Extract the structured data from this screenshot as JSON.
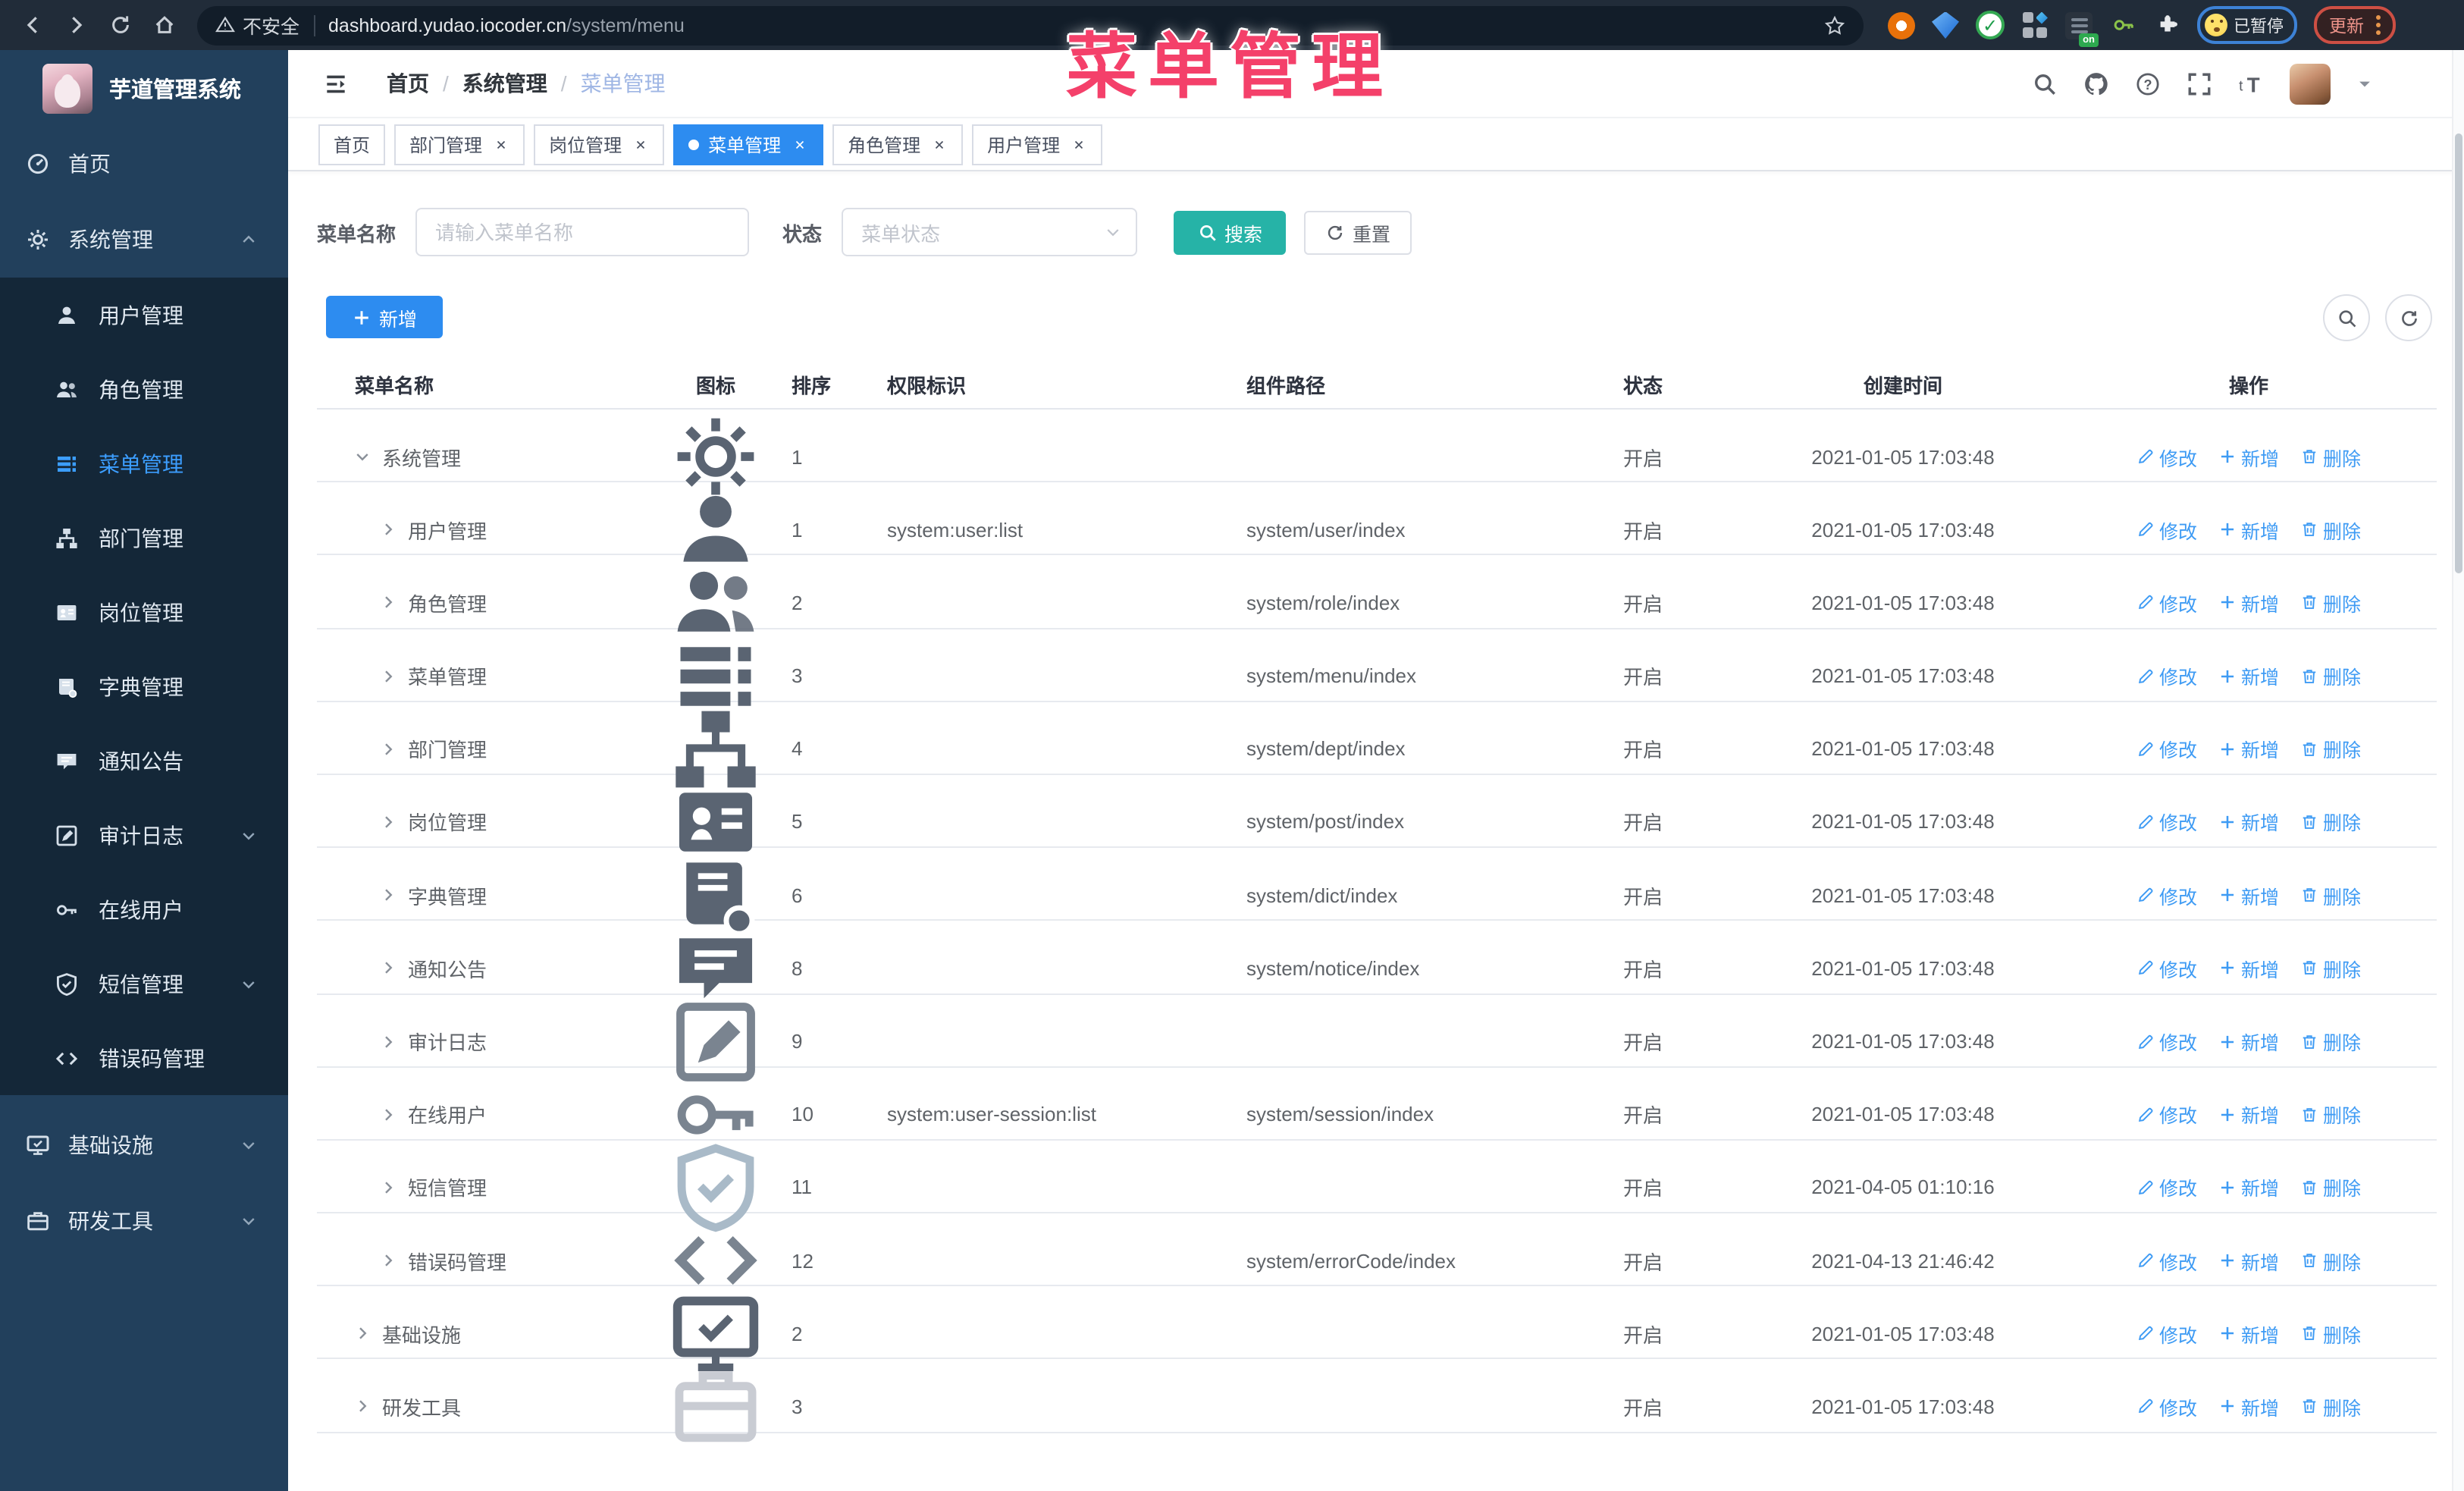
{
  "browser": {
    "security_label": "不安全",
    "url_domain": "dashboard.yudao.iocoder.cn",
    "url_path": "/system/menu",
    "extension_on_badge": "on",
    "paused_badge_label": "已暂停",
    "update_button_label": "更新"
  },
  "watermark": "菜单管理",
  "sidebar": {
    "app_title": "芋道管理系统",
    "items": [
      {
        "label": "首页",
        "icon": "dashboard",
        "sub": false,
        "caret": null,
        "active": false
      },
      {
        "label": "系统管理",
        "icon": "gear",
        "sub": false,
        "caret": "up",
        "active": false
      },
      {
        "label": "用户管理",
        "icon": "user",
        "sub": true,
        "caret": null,
        "active": false
      },
      {
        "label": "角色管理",
        "icon": "users",
        "sub": true,
        "caret": null,
        "active": false
      },
      {
        "label": "菜单管理",
        "icon": "menu",
        "sub": true,
        "caret": null,
        "active": true
      },
      {
        "label": "部门管理",
        "icon": "tree",
        "sub": true,
        "caret": null,
        "active": false
      },
      {
        "label": "岗位管理",
        "icon": "badge",
        "sub": true,
        "caret": null,
        "active": false
      },
      {
        "label": "字典管理",
        "icon": "dict",
        "sub": true,
        "caret": null,
        "active": false
      },
      {
        "label": "通知公告",
        "icon": "announce",
        "sub": true,
        "caret": null,
        "active": false
      },
      {
        "label": "审计日志",
        "icon": "log",
        "sub": true,
        "caret": "down",
        "active": false
      },
      {
        "label": "在线用户",
        "icon": "key",
        "sub": true,
        "caret": null,
        "active": false
      },
      {
        "label": "短信管理",
        "icon": "shield",
        "sub": true,
        "caret": "down",
        "active": false
      },
      {
        "label": "错误码管理",
        "icon": "code",
        "sub": true,
        "caret": null,
        "active": false
      },
      {
        "label": "基础设施",
        "icon": "monitor",
        "sub": false,
        "caret": "down",
        "active": false,
        "gap": true
      },
      {
        "label": "研发工具",
        "icon": "tool",
        "sub": false,
        "caret": "down",
        "active": false
      }
    ]
  },
  "topbar": {
    "breadcrumbs": [
      "首页",
      "系统管理",
      "菜单管理"
    ],
    "separator": "/"
  },
  "tabs": [
    {
      "label": "首页",
      "closable": false,
      "active": false
    },
    {
      "label": "部门管理",
      "closable": true,
      "active": false
    },
    {
      "label": "岗位管理",
      "closable": true,
      "active": false
    },
    {
      "label": "菜单管理",
      "closable": true,
      "active": true
    },
    {
      "label": "角色管理",
      "closable": true,
      "active": false
    },
    {
      "label": "用户管理",
      "closable": true,
      "active": false
    }
  ],
  "filters": {
    "name_label": "菜单名称",
    "name_placeholder": "请输入菜单名称",
    "status_label": "状态",
    "status_placeholder": "菜单状态",
    "search_label": "搜索",
    "reset_label": "重置"
  },
  "toolbar": {
    "add_label": "新增"
  },
  "table": {
    "columns": [
      "菜单名称",
      "图标",
      "排序",
      "权限标识",
      "组件路径",
      "状态",
      "创建时间",
      "操作"
    ],
    "action_labels": [
      "修改",
      "新增",
      "删除"
    ],
    "rows": [
      {
        "name": "系统管理",
        "level": 0,
        "expanded": true,
        "icon": "gear",
        "tone": "",
        "sort": "1",
        "perm": "",
        "path": "",
        "status": "开启",
        "time": "2021-01-05 17:03:48"
      },
      {
        "name": "用户管理",
        "level": 1,
        "expanded": false,
        "icon": "user",
        "tone": "",
        "sort": "1",
        "perm": "system:user:list",
        "path": "system/user/index",
        "status": "开启",
        "time": "2021-01-05 17:03:48"
      },
      {
        "name": "角色管理",
        "level": 1,
        "expanded": false,
        "icon": "users",
        "tone": "",
        "sort": "2",
        "perm": "",
        "path": "system/role/index",
        "status": "开启",
        "time": "2021-01-05 17:03:48"
      },
      {
        "name": "菜单管理",
        "level": 1,
        "expanded": false,
        "icon": "menu",
        "tone": "",
        "sort": "3",
        "perm": "",
        "path": "system/menu/index",
        "status": "开启",
        "time": "2021-01-05 17:03:48"
      },
      {
        "name": "部门管理",
        "level": 1,
        "expanded": false,
        "icon": "tree",
        "tone": "",
        "sort": "4",
        "perm": "",
        "path": "system/dept/index",
        "status": "开启",
        "time": "2021-01-05 17:03:48"
      },
      {
        "name": "岗位管理",
        "level": 1,
        "expanded": false,
        "icon": "badge",
        "tone": "",
        "sort": "5",
        "perm": "",
        "path": "system/post/index",
        "status": "开启",
        "time": "2021-01-05 17:03:48"
      },
      {
        "name": "字典管理",
        "level": 1,
        "expanded": false,
        "icon": "dict",
        "tone": "",
        "sort": "6",
        "perm": "",
        "path": "system/dict/index",
        "status": "开启",
        "time": "2021-01-05 17:03:48"
      },
      {
        "name": "通知公告",
        "level": 1,
        "expanded": false,
        "icon": "announce",
        "tone": "",
        "sort": "8",
        "perm": "",
        "path": "system/notice/index",
        "status": "开启",
        "time": "2021-01-05 17:03:48"
      },
      {
        "name": "审计日志",
        "level": 1,
        "expanded": false,
        "icon": "log",
        "tone": "mid",
        "sort": "9",
        "perm": "",
        "path": "",
        "status": "开启",
        "time": "2021-01-05 17:03:48"
      },
      {
        "name": "在线用户",
        "level": 1,
        "expanded": false,
        "icon": "key",
        "tone": "mid",
        "sort": "10",
        "perm": "system:user-session:list",
        "path": "system/session/index",
        "status": "开启",
        "time": "2021-01-05 17:03:48"
      },
      {
        "name": "短信管理",
        "level": 1,
        "expanded": false,
        "icon": "shield",
        "tone": "light",
        "sort": "11",
        "perm": "",
        "path": "",
        "status": "开启",
        "time": "2021-04-05 01:10:16"
      },
      {
        "name": "错误码管理",
        "level": 1,
        "expanded": false,
        "icon": "code",
        "tone": "mid",
        "sort": "12",
        "perm": "",
        "path": "system/errorCode/index",
        "status": "开启",
        "time": "2021-04-13 21:46:42"
      },
      {
        "name": "基础设施",
        "level": 0,
        "expanded": false,
        "icon": "monitor",
        "tone": "",
        "sort": "2",
        "perm": "",
        "path": "",
        "status": "开启",
        "time": "2021-01-05 17:03:48"
      },
      {
        "name": "研发工具",
        "level": 0,
        "expanded": false,
        "icon": "tool",
        "tone": "fade",
        "sort": "3",
        "perm": "",
        "path": "",
        "status": "开启",
        "time": "2021-01-05 17:03:48"
      }
    ]
  }
}
